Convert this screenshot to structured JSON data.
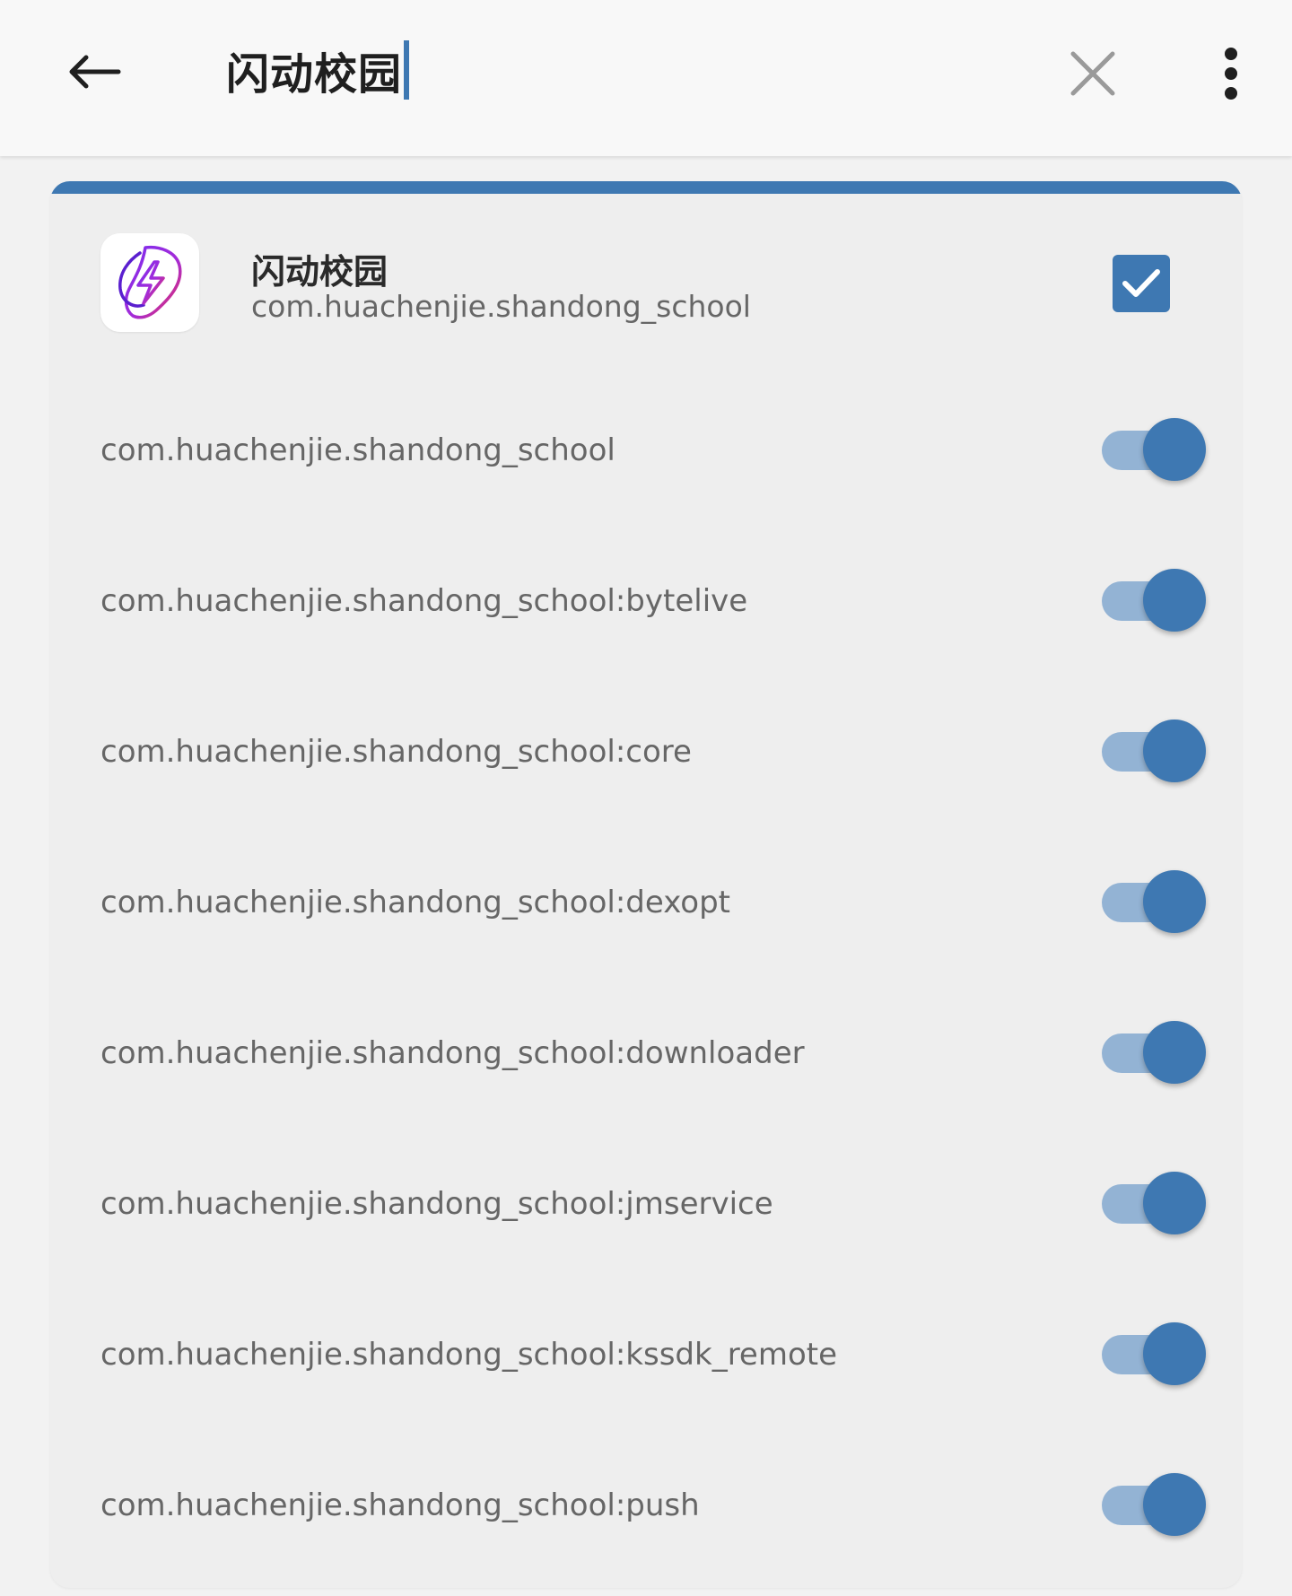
{
  "toolbar": {
    "back_icon": "arrow-left-icon",
    "search_query": "闪动校园",
    "clear_icon": "close-icon",
    "more_icon": "more-vert-icon"
  },
  "app": {
    "name": "闪动校园",
    "package": "com.huachenjie.shandong_school",
    "icon": "lightning-bolt-app-icon",
    "selected": true
  },
  "processes": [
    {
      "name": "com.huachenjie.shandong_school",
      "enabled": true
    },
    {
      "name": "com.huachenjie.shandong_school:bytelive",
      "enabled": true
    },
    {
      "name": "com.huachenjie.shandong_school:core",
      "enabled": true
    },
    {
      "name": "com.huachenjie.shandong_school:dexopt",
      "enabled": true
    },
    {
      "name": "com.huachenjie.shandong_school:downloader",
      "enabled": true
    },
    {
      "name": "com.huachenjie.shandong_school:jmservice",
      "enabled": true
    },
    {
      "name": "com.huachenjie.shandong_school:kssdk_remote",
      "enabled": true
    },
    {
      "name": "com.huachenjie.shandong_school:push",
      "enabled": true
    }
  ],
  "colors": {
    "accent": "#3e78b2",
    "switch_track_on": "#93b3d4",
    "card_background": "#eeeeee",
    "toolbar_background": "#f8f8f8"
  }
}
